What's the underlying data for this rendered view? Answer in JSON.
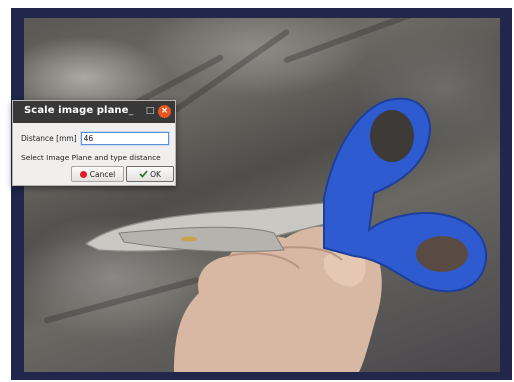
{
  "dialog": {
    "title": "Scale image plane",
    "minimize_glyph": "_",
    "maximize_glyph": "□",
    "close_glyph": "×",
    "distance_label": "Distance [mm]",
    "distance_value": "46",
    "instructions": "Select Image Plane and type distance",
    "cancel_label": "Cancel",
    "ok_label": "OK",
    "close_color": "#e95420",
    "cancel_icon_color": "#e01b24"
  },
  "scene": {
    "scissors_handle_color": "#2f5bd0",
    "frame_color": "#21264a",
    "icons": [
      "cancel-icon",
      "ok-check-icon",
      "close-icon",
      "minimize-icon",
      "maximize-icon"
    ]
  }
}
